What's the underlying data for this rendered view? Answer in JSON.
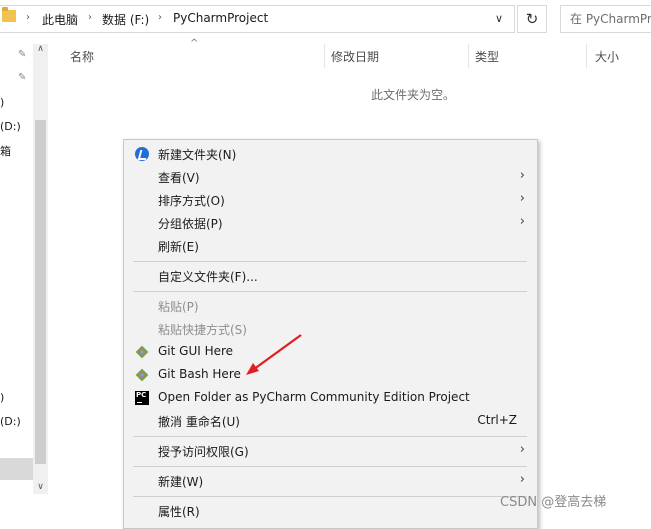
{
  "address": {
    "crumbs": [
      "此电脑",
      "数据 (F:)",
      "PyCharmProject"
    ],
    "search_placeholder": "在 PyCharmProject"
  },
  "nav": {
    "labels": [
      ")",
      "(D:)",
      "箱",
      ")",
      "(D:)"
    ]
  },
  "columns": {
    "name": "名称",
    "modified": "修改日期",
    "type": "类型",
    "size": "大小"
  },
  "empty_message": "此文件夹为空。",
  "menu": {
    "items": [
      {
        "label": "新建文件夹(N)",
        "icon": "new-folder-icon"
      },
      {
        "label": "查看(V)",
        "submenu": true
      },
      {
        "label": "排序方式(O)",
        "submenu": true
      },
      {
        "label": "分组依据(P)",
        "submenu": true
      },
      {
        "label": "刷新(E)"
      },
      {
        "label": "自定义文件夹(F)..."
      },
      {
        "label": "粘贴(P)",
        "disabled": true
      },
      {
        "label": "粘贴快捷方式(S)",
        "disabled": true
      },
      {
        "label": "Git GUI Here",
        "icon": "git-icon"
      },
      {
        "label": "Git Bash Here",
        "icon": "git-icon"
      },
      {
        "label": "Open Folder as PyCharm Community Edition Project",
        "icon": "pycharm-icon"
      },
      {
        "label": "撤消 重命名(U)",
        "shortcut": "Ctrl+Z"
      },
      {
        "label": "授予访问权限(G)",
        "submenu": true
      },
      {
        "label": "新建(W)",
        "submenu": true
      },
      {
        "label": "属性(R)"
      }
    ]
  },
  "pycharm_icon_text": "PC",
  "watermark": "CSDN @登高去梯",
  "colors": {
    "menu_bg": "#f2f2f2",
    "arrow_annotation": "#e02020",
    "new_folder_icon": "#1e6fd9"
  }
}
